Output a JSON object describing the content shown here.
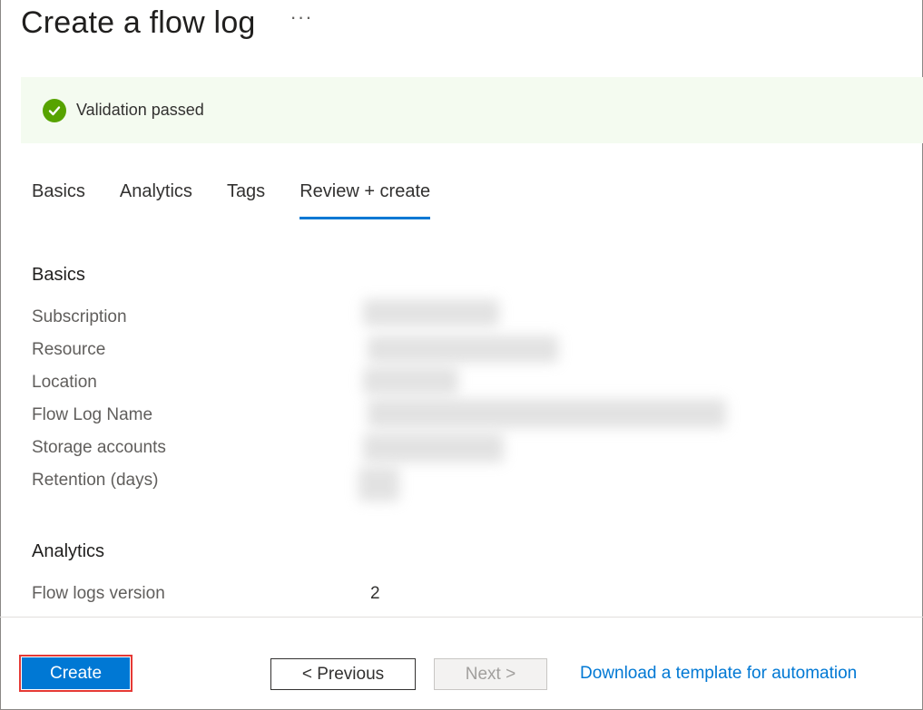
{
  "header": {
    "title": "Create a flow log",
    "more_label": "···"
  },
  "validation": {
    "status_text": "Validation passed",
    "icon": "check-circle-icon",
    "color": "#57a300"
  },
  "tabs": [
    {
      "label": "Basics",
      "active": false
    },
    {
      "label": "Analytics",
      "active": false
    },
    {
      "label": "Tags",
      "active": false
    },
    {
      "label": "Review + create",
      "active": true
    }
  ],
  "basics": {
    "heading": "Basics",
    "fields": [
      {
        "label": "Subscription"
      },
      {
        "label": "Resource"
      },
      {
        "label": "Location"
      },
      {
        "label": "Flow Log Name"
      },
      {
        "label": "Storage accounts"
      },
      {
        "label": "Retention (days)"
      }
    ]
  },
  "analytics": {
    "heading": "Analytics",
    "fields": [
      {
        "label": "Flow logs version",
        "value": "2"
      }
    ]
  },
  "footer": {
    "create_label": "Create",
    "previous_label": "< Previous",
    "next_label": "Next >",
    "download_label": "Download a template for automation"
  },
  "colors": {
    "accent": "#0078d4",
    "highlight": "#e53935",
    "banner_bg": "#f4fbf0"
  }
}
